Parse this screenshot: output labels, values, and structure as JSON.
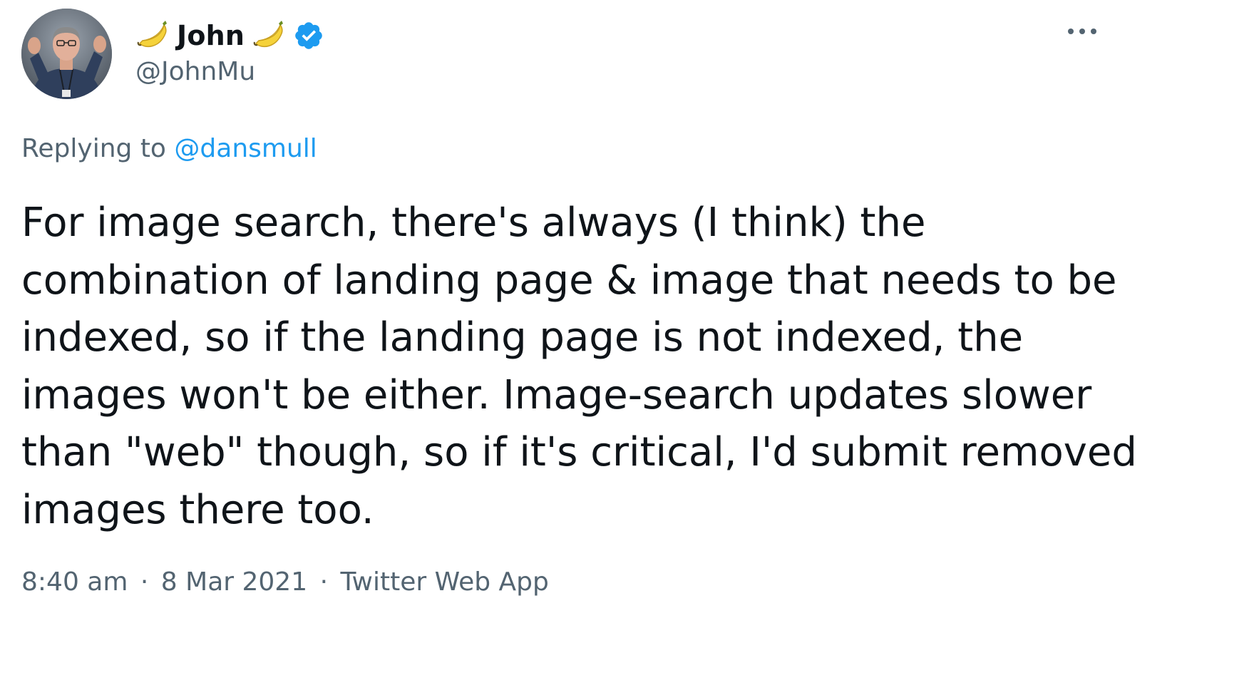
{
  "author": {
    "display_name": "John",
    "name_emoji_left": "banana-emoji",
    "name_emoji_right": "banana-emoji",
    "handle": "@JohnMu",
    "verified": true,
    "verified_color": "#1d9bf0"
  },
  "reply": {
    "prefix": "Replying to",
    "mention": "@dansmull",
    "mention_color": "#1d9bf0"
  },
  "tweet": {
    "lines": [
      "For image search, there's always (I think) the",
      "combination of landing page & image that needs to be",
      "indexed, so if the landing page is not indexed, the",
      "images won't be either. Image-search updates slower",
      "than \"web\" though, so if it's critical, I'd submit removed",
      "images there too."
    ]
  },
  "meta": {
    "time": "8:40 am",
    "separator": "·",
    "date": "8 Mar 2021",
    "source": "Twitter Web App"
  },
  "icons": {
    "more": "more-horizontal-icon",
    "verified": "verified-badge-icon"
  },
  "colors": {
    "text_primary": "#0f1419",
    "text_secondary": "#536471",
    "accent": "#1d9bf0",
    "background": "#ffffff"
  }
}
